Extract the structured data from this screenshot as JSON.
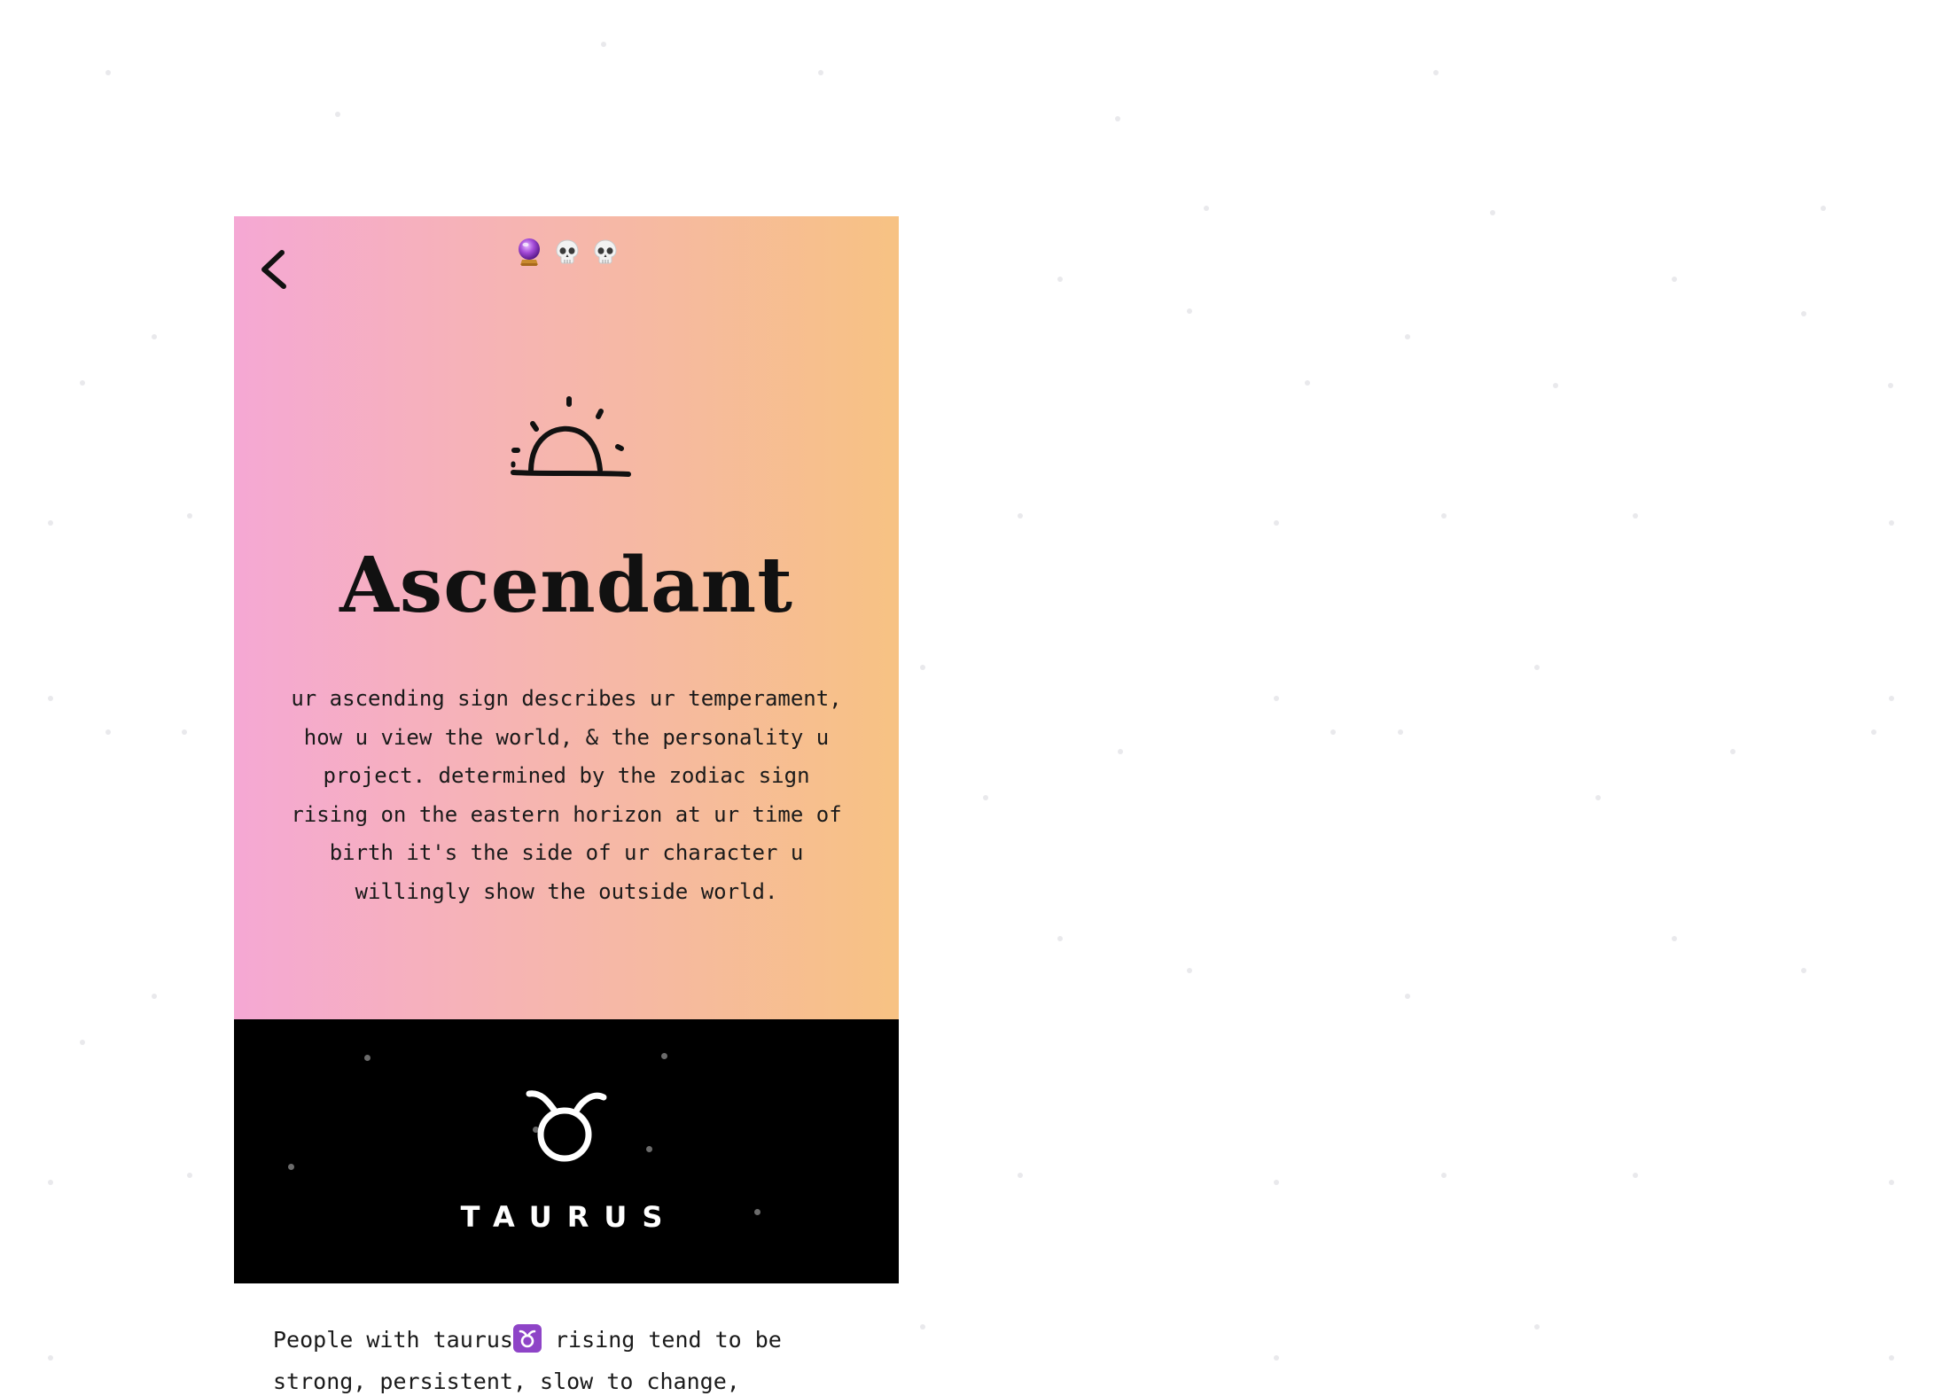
{
  "header": {
    "back_label": "<",
    "progress_emojis": [
      {
        "icon": "crystal-ball-icon",
        "state": "active"
      },
      {
        "icon": "skull-icon",
        "state": "pending"
      },
      {
        "icon": "skull-icon",
        "state": "pending"
      }
    ]
  },
  "hero": {
    "icon": "sunrise-icon",
    "title": "Ascendant",
    "description": "ur ascending sign describes ur temperament, how u view the world, & the personality u project. determined by the zodiac sign rising on the eastern horizon at ur time of birth it's the side of ur character u willingly show the outside world.",
    "gradient": {
      "start": "#f5a8d4",
      "end": "#f7c283"
    }
  },
  "sign": {
    "glyph": "♉",
    "icon": "taurus-icon",
    "name": "TAURUS",
    "background": "#000000"
  },
  "body": {
    "intro_before": "People with taurus",
    "intro_icon": "taurus-emoji-icon",
    "intro_after": " rising tend to be strong, persistent, slow to change,"
  }
}
